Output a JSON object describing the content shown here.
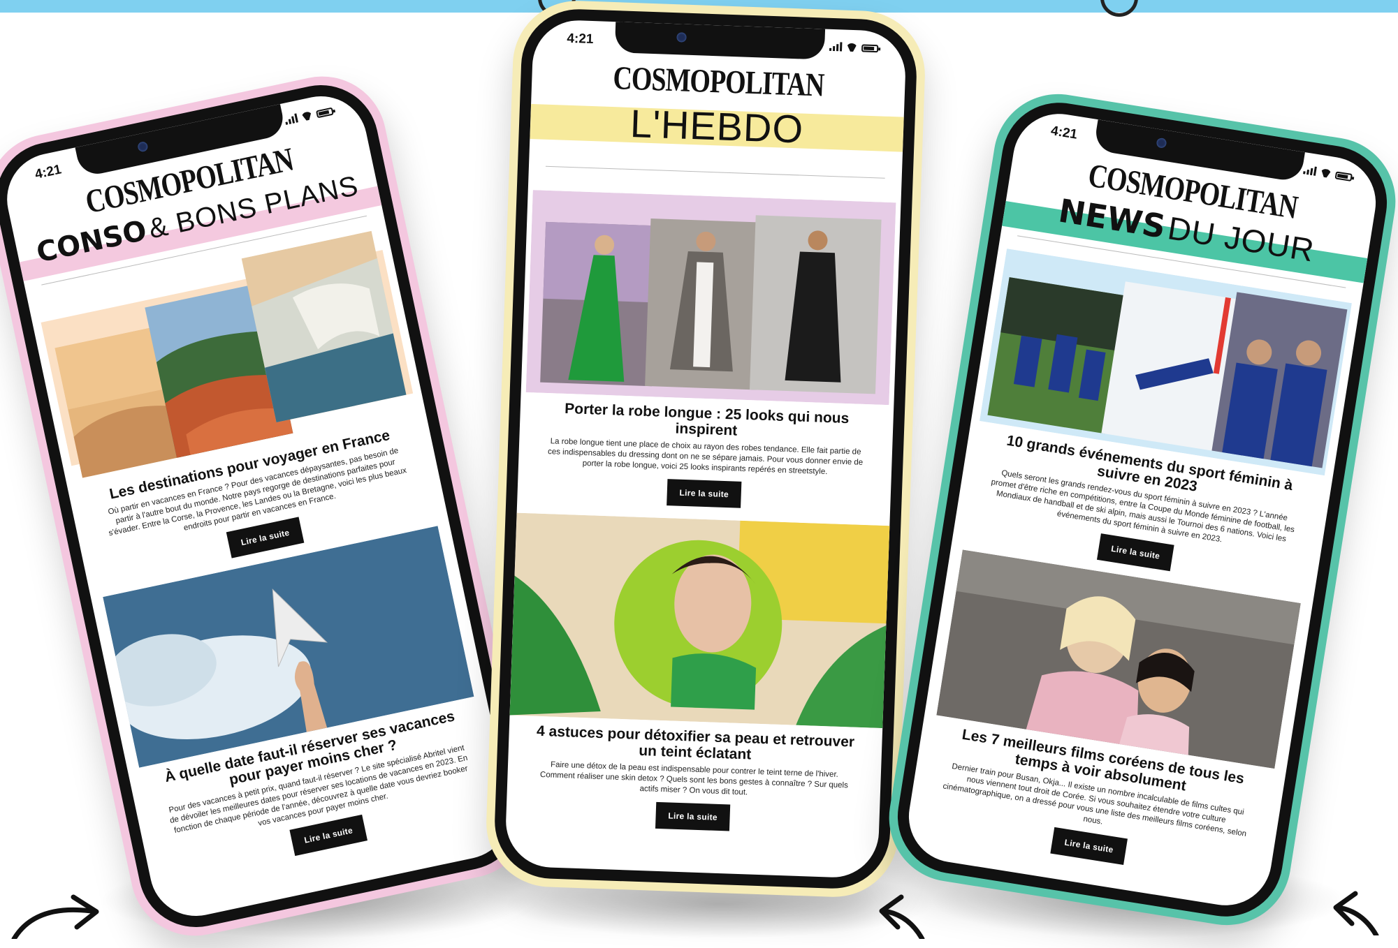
{
  "colors": {
    "pink_case": "#f4c7df",
    "yellow_case": "#f6ecb7",
    "teal_case": "#57c3a9",
    "pink_band": "#f4c9df",
    "yellow_band": "#f7ea9c",
    "teal_band": "#4cc5a5",
    "blue_band": "#7fd0f0",
    "lilac_band": "#e6cce6",
    "peach_band": "#fbe0c4"
  },
  "phones": [
    {
      "time": "4:21",
      "logo": "COSMOPOLITAN",
      "section_strong": "CONSO",
      "section_light": "& BONS PLANS",
      "articles": [
        {
          "title": "Les destinations pour voyager en France",
          "body": "Où partir en vacances en France ? Pour des vacances dépaysantes, pas besoin de partir à l'autre bout du monde. Notre pays regorge de destinations parfaites pour s'évader. Entre la Corse, la Provence, les Landes ou la Bretagne, voici les plus beaux endroits pour partir en vacances en France.",
          "button": "Lire la suite"
        },
        {
          "title": "À quelle date faut-il réserver ses vacances pour payer moins cher ?",
          "body": "Pour des vacances à petit prix, quand faut-il réserver ? Le site spécialisé Abritel vient de dévoiler les meilleures dates pour réserver ses locations de vacances en 2023. En fonction de chaque période de l'année, découvrez à quelle date vous devriez booker vos vacances pour payer moins cher.",
          "button": "Lire la suite"
        }
      ]
    },
    {
      "time": "4:21",
      "logo": "COSMOPOLITAN",
      "section_light": "L'HEBDO",
      "articles": [
        {
          "title": "Porter la robe longue : 25 looks qui nous inspirent",
          "body": "La robe longue tient une place de choix au rayon des robes tendance. Elle fait partie de ces indispensables du dressing dont on ne se sépare jamais. Pour vous donner envie de porter la robe longue, voici 25 looks inspirants repérés en streetstyle.",
          "button": "Lire la suite"
        },
        {
          "title": "4 astuces pour détoxifier sa peau et retrouver un teint éclatant",
          "body": "Faire une détox de la peau est indispensable pour contrer le teint terne de l'hiver. Comment réaliser une skin detox ? Quels sont les bons gestes à connaître ? Sur quels actifs miser ? On vous dit tout.",
          "button": "Lire la suite"
        }
      ]
    },
    {
      "time": "4:21",
      "logo": "COSMOPOLITAN",
      "section_strong": "NEWS",
      "section_light": "DU JOUR",
      "articles": [
        {
          "title": "10 grands événements du sport féminin à suivre en 2023",
          "body": "Quels seront les grands rendez-vous du sport féminin à suivre en 2023 ? L'année promet d'être riche en compétitions, entre la Coupe du Monde féminine de football, les Mondiaux de handball et de ski alpin, mais aussi le Tournoi des 6 nations. Voici les événements du sport féminin à suivre en 2023.",
          "button": "Lire la suite"
        },
        {
          "title": "Les 7 meilleurs films coréens de tous les temps à voir absolument",
          "body": "Dernier train pour Busan, Okja... Il existe un nombre incalculable de films cultes qui nous viennent tout droit de Corée. Si vous souhaitez étendre votre culture cinématographique, on a dressé pour vous une liste des meilleurs films coréens, selon nous.",
          "button": "Lire la suite"
        }
      ]
    }
  ]
}
